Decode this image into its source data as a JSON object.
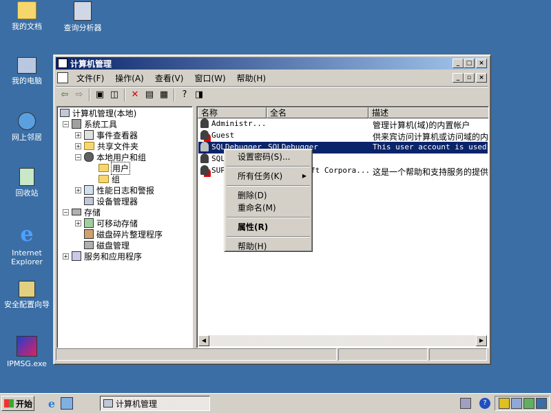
{
  "desktop": {
    "icons": [
      {
        "label": "我的文档"
      },
      {
        "label": "查询分析器"
      },
      {
        "label": "我的电脑"
      },
      {
        "label": "网上邻居"
      },
      {
        "label": "回收站"
      },
      {
        "label": "Internet Explorer"
      },
      {
        "label": "安全配置向导"
      },
      {
        "label": "IPMSG.exe"
      }
    ]
  },
  "window": {
    "title": "计算机管理",
    "menu": [
      "文件(F)",
      "操作(A)",
      "查看(V)",
      "窗口(W)",
      "帮助(H)"
    ],
    "tree": [
      {
        "label": "计算机管理(本地)"
      },
      {
        "label": "系统工具"
      },
      {
        "label": "事件查看器"
      },
      {
        "label": "共享文件夹"
      },
      {
        "label": "本地用户和组"
      },
      {
        "label": "用户"
      },
      {
        "label": "组"
      },
      {
        "label": "性能日志和警报"
      },
      {
        "label": "设备管理器"
      },
      {
        "label": "存储"
      },
      {
        "label": "可移动存储"
      },
      {
        "label": "磁盘碎片整理程序"
      },
      {
        "label": "磁盘管理"
      },
      {
        "label": "服务和应用程序"
      }
    ],
    "list": {
      "headers": [
        "名称",
        "全名",
        "描述"
      ],
      "rows": [
        {
          "name": "Administr...",
          "full": "",
          "desc": "管理计算机(域)的内置帐户"
        },
        {
          "name": "Guest",
          "full": "",
          "desc": "供来宾访问计算机或访问域的内"
        },
        {
          "name": "SQLDebugger",
          "full": "SQLDebugger",
          "desc": "This user account is used by"
        },
        {
          "name": "SQL",
          "full": "",
          "desc": ""
        },
        {
          "name": "SUP",
          "full": "ft Corpora...",
          "desc": "这是一个帮助和支持服务的提供"
        }
      ]
    }
  },
  "context_menu": {
    "items": [
      {
        "label": "设置密码(S)..."
      },
      {
        "label": "所有任务(K)"
      },
      {
        "label": "删除(D)"
      },
      {
        "label": "重命名(M)"
      },
      {
        "label": "属性(R)"
      },
      {
        "label": "帮助(H)"
      }
    ]
  },
  "taskbar": {
    "start_label": "开始",
    "task_label": "计算机管理"
  }
}
